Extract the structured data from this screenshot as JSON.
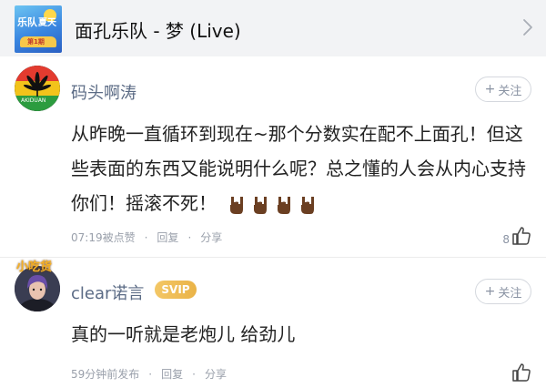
{
  "song": {
    "title": "面孔乐队 - 梦 (Live)",
    "album_art_text": [
      "乐队",
      "夏天",
      "第1期"
    ]
  },
  "comments": [
    {
      "username": "码头啊涛",
      "avatar_text": "AKIDUAN",
      "follow_label": "关注",
      "text": "从昨晚一直循环到现在~那个分数实在配不上面孔！但这些表面的东西又能说明什么呢？总之懂的人会从内心支持你们！摇滚不死！",
      "emoji": [
        "rock-hand-icon",
        "rock-hand-icon",
        "rock-hand-icon",
        "rock-hand-icon"
      ],
      "meta": {
        "time": "07:19被点赞",
        "reply_label": "回复",
        "share_label": "分享"
      },
      "likes": "8"
    },
    {
      "username": "clear诺言",
      "badge": "SVIP",
      "avatar_badge_text": "小吃货",
      "follow_label": "关注",
      "text": "真的一听就是老炮儿 给劲儿",
      "meta": {
        "time": "59分钟前发布",
        "reply_label": "回复",
        "share_label": "分享"
      },
      "likes": ""
    }
  ],
  "colors": {
    "username": "#5b6b85",
    "svip_badge": "#eab347",
    "meta": "#9aa0ab",
    "header_bg": "#f2f3f5"
  }
}
